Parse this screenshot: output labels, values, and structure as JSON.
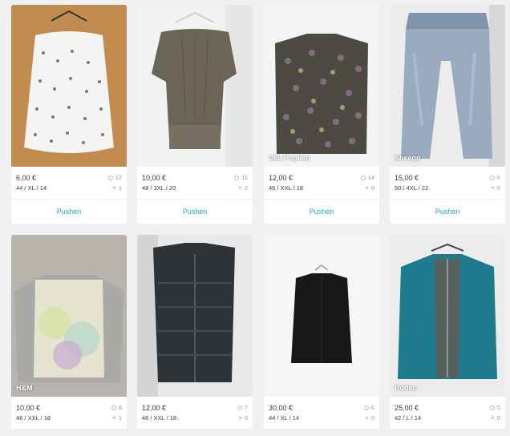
{
  "colors": {
    "accent": "#21a7b2",
    "text": "#333b40",
    "muted": "#8f979c"
  },
  "items": [
    {
      "price": "6,00 €",
      "size": "44 / XL / 14",
      "views": "12",
      "likes": "1",
      "brand": "",
      "push": "Pushen"
    },
    {
      "price": "10,00 €",
      "size": "48 / 3XL / 20",
      "views": "11",
      "likes": "2",
      "brand": "",
      "push": "Pushen"
    },
    {
      "price": "12,00 €",
      "size": "46 / XXL / 18",
      "views": "14",
      "likes": "0",
      "brand": "Ulla Popken",
      "push": "Pushen"
    },
    {
      "price": "15,00 €",
      "size": "50 / 4XL / 22",
      "views": "6",
      "likes": "0",
      "brand": "Sheego",
      "push": "Pushen"
    },
    {
      "price": "10,00 €",
      "size": "46 / XXL / 18",
      "views": "8",
      "likes": "1",
      "brand": "H&M",
      "push": ""
    },
    {
      "price": "12,00 €",
      "size": "46 / XXL / 18",
      "views": "7",
      "likes": "0",
      "brand": "",
      "push": ""
    },
    {
      "price": "30,00 €",
      "size": "44 / XL / 14",
      "views": "6",
      "likes": "0",
      "brand": "",
      "push": ""
    },
    {
      "price": "25,00 €",
      "size": "42 / L / 14",
      "views": "5",
      "likes": "0",
      "brand": "Rodeo",
      "push": ""
    }
  ]
}
